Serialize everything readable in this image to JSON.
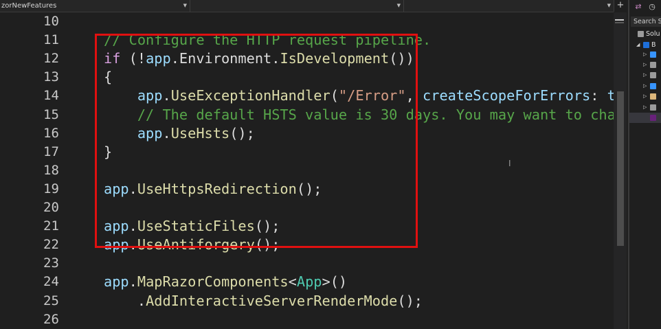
{
  "navbar": {
    "project": "zorNewFeatures",
    "type": "",
    "member": "",
    "add_tab": "+",
    "split": "▾"
  },
  "editor": {
    "lines": [
      {
        "n": "10",
        "tokens": []
      },
      {
        "n": "11",
        "tokens": [
          {
            "t": "// Configure the HTTP request pipeline.",
            "c": "comment"
          }
        ]
      },
      {
        "n": "12",
        "tokens": [
          {
            "t": "if",
            "c": "kw"
          },
          {
            "t": " (!",
            "c": "punct"
          },
          {
            "t": "app",
            "c": "var"
          },
          {
            "t": ".",
            "c": "punct"
          },
          {
            "t": "Environment",
            "c": "punct"
          },
          {
            "t": ".",
            "c": "punct"
          },
          {
            "t": "IsDevelopment",
            "c": "method"
          },
          {
            "t": "())",
            "c": "punct"
          }
        ]
      },
      {
        "n": "13",
        "tokens": [
          {
            "t": "{",
            "c": "punct"
          }
        ]
      },
      {
        "n": "14",
        "tokens": [
          {
            "t": "    ",
            "c": "punct"
          },
          {
            "t": "app",
            "c": "var"
          },
          {
            "t": ".",
            "c": "punct"
          },
          {
            "t": "UseExceptionHandler",
            "c": "method"
          },
          {
            "t": "(",
            "c": "punct"
          },
          {
            "t": "\"/Error\"",
            "c": "str"
          },
          {
            "t": ", ",
            "c": "punct"
          },
          {
            "t": "createScopeForErrors",
            "c": "param"
          },
          {
            "t": ": ",
            "c": "punct"
          },
          {
            "t": "t",
            "c": "var"
          }
        ]
      },
      {
        "n": "15",
        "tokens": [
          {
            "t": "    ",
            "c": "punct"
          },
          {
            "t": "// The default HSTS value is 30 days. You may want to cha",
            "c": "comment"
          }
        ]
      },
      {
        "n": "16",
        "tokens": [
          {
            "t": "    ",
            "c": "punct"
          },
          {
            "t": "app",
            "c": "var"
          },
          {
            "t": ".",
            "c": "punct"
          },
          {
            "t": "UseHsts",
            "c": "method"
          },
          {
            "t": "();",
            "c": "punct"
          }
        ]
      },
      {
        "n": "17",
        "tokens": [
          {
            "t": "}",
            "c": "punct"
          }
        ]
      },
      {
        "n": "18",
        "tokens": []
      },
      {
        "n": "19",
        "tokens": [
          {
            "t": "app",
            "c": "var"
          },
          {
            "t": ".",
            "c": "punct"
          },
          {
            "t": "UseHttpsRedirection",
            "c": "method"
          },
          {
            "t": "();",
            "c": "punct"
          }
        ]
      },
      {
        "n": "20",
        "tokens": []
      },
      {
        "n": "21",
        "tokens": [
          {
            "t": "app",
            "c": "var"
          },
          {
            "t": ".",
            "c": "punct"
          },
          {
            "t": "UseStaticFiles",
            "c": "method"
          },
          {
            "t": "();",
            "c": "punct"
          }
        ]
      },
      {
        "n": "22",
        "tokens": [
          {
            "t": "app",
            "c": "var"
          },
          {
            "t": ".",
            "c": "punct"
          },
          {
            "t": "UseAntiforgery",
            "c": "method"
          },
          {
            "t": "();",
            "c": "punct"
          }
        ]
      },
      {
        "n": "23",
        "tokens": []
      },
      {
        "n": "24",
        "tokens": [
          {
            "t": "app",
            "c": "var"
          },
          {
            "t": ".",
            "c": "punct"
          },
          {
            "t": "MapRazorComponents",
            "c": "method"
          },
          {
            "t": "<",
            "c": "punct"
          },
          {
            "t": "App",
            "c": "type"
          },
          {
            "t": ">()",
            "c": "punct"
          }
        ]
      },
      {
        "n": "25",
        "tokens": [
          {
            "t": "    .",
            "c": "punct"
          },
          {
            "t": "AddInteractiveServerRenderMode",
            "c": "method"
          },
          {
            "t": "();",
            "c": "punct"
          }
        ]
      },
      {
        "n": "26",
        "tokens": []
      }
    ]
  },
  "solution_explorer": {
    "search_placeholder": "Search So",
    "tree": [
      {
        "label": "Solu",
        "arrow": "",
        "icon": "solution-icon",
        "color": "#9b9b9b"
      },
      {
        "label": "B",
        "arrow": "◢",
        "icon": "project-icon",
        "color": "#1e6fd9"
      },
      {
        "label": "",
        "arrow": "▷",
        "icon": "connected-services-icon",
        "color": "#3794ff"
      },
      {
        "label": "",
        "arrow": "▷",
        "icon": "dependencies-icon",
        "color": "#9b9b9b"
      },
      {
        "label": "",
        "arrow": "▷",
        "icon": "properties-icon",
        "color": "#9b9b9b"
      },
      {
        "label": "",
        "arrow": "▷",
        "icon": "wwwroot-icon",
        "color": "#3794ff"
      },
      {
        "label": "",
        "arrow": "▷",
        "icon": "folder-icon",
        "color": "#dcb67a"
      },
      {
        "label": "",
        "arrow": "▷",
        "icon": "file-icon",
        "color": "#9b9b9b"
      },
      {
        "label": "",
        "arrow": "",
        "icon": "csharp-file-icon",
        "color": "#68217a"
      }
    ]
  }
}
